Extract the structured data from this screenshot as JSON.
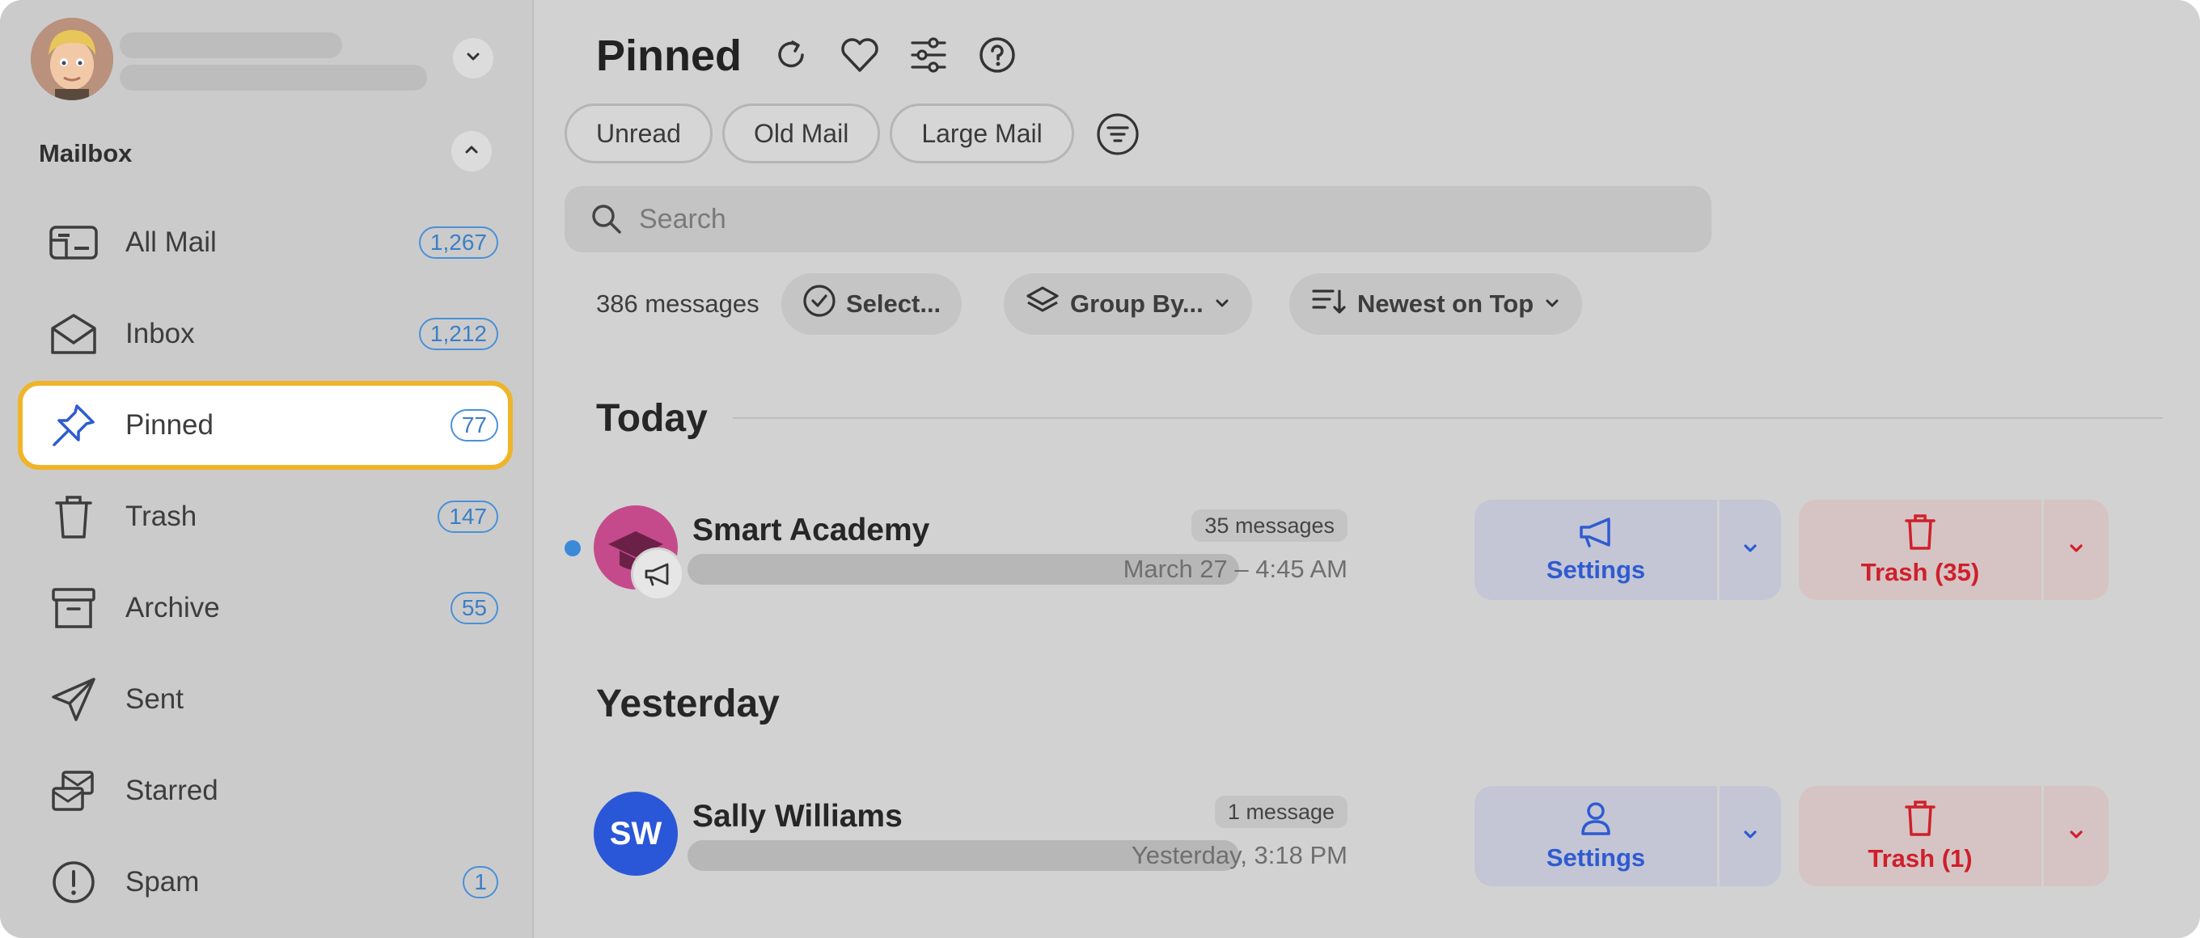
{
  "sidebar": {
    "section_title": "Mailbox",
    "items": [
      {
        "label": "All Mail",
        "count": "1,267",
        "icon": "all-mail-icon"
      },
      {
        "label": "Inbox",
        "count": "1,212",
        "icon": "inbox-icon"
      },
      {
        "label": "Pinned",
        "count": "77",
        "icon": "pin-icon",
        "active": true
      },
      {
        "label": "Trash",
        "count": "147",
        "icon": "trash-icon"
      },
      {
        "label": "Archive",
        "count": "55",
        "icon": "archive-icon"
      },
      {
        "label": "Sent",
        "count": "",
        "icon": "send-icon"
      },
      {
        "label": "Starred",
        "count": "",
        "icon": "starred-icon"
      },
      {
        "label": "Spam",
        "count": "1",
        "icon": "spam-icon"
      }
    ]
  },
  "main": {
    "title": "Pinned",
    "filters": [
      "Unread",
      "Old Mail",
      "Large Mail"
    ],
    "search_placeholder": "Search",
    "message_count": "386 messages",
    "tools": {
      "select": "Select...",
      "group_by": "Group By...",
      "sort": "Newest on Top"
    },
    "groups": [
      {
        "title": "Today",
        "rows": [
          {
            "sender": "Smart Academy",
            "count": "35 messages",
            "date": "March 27 – 4:45 AM",
            "settings_label": "Settings",
            "trash_label": "Trash (35)",
            "unread": true
          }
        ]
      },
      {
        "title": "Yesterday",
        "rows": [
          {
            "sender": "Sally Williams",
            "initials": "SW",
            "count": "1 message",
            "date": "Yesterday, 3:18 PM",
            "settings_label": "Settings",
            "trash_label": "Trash (1)",
            "unread": false
          }
        ]
      }
    ]
  },
  "colors": {
    "accent_blue": "#2f5bd1",
    "count_blue": "#3b7fc7",
    "trash_red": "#cf1f2b",
    "highlight_yellow": "#f0b429",
    "unread_dot": "#3a8ad8",
    "avatar_pink": "#c54a8c",
    "avatar_blue": "#2a57d8"
  }
}
